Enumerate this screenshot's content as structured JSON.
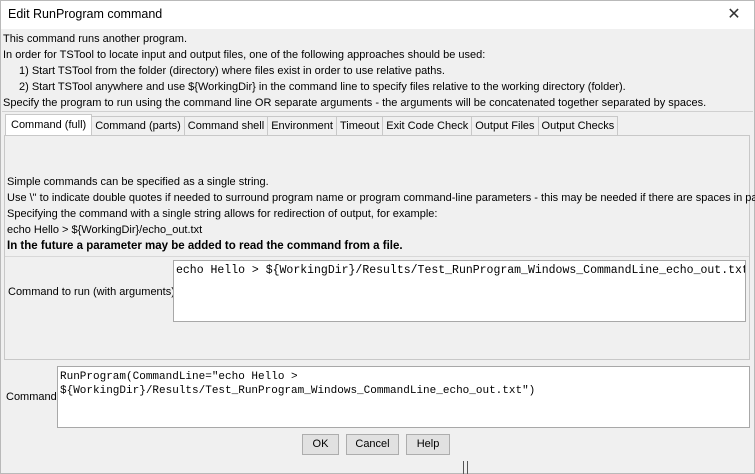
{
  "window": {
    "title": "Edit RunProgram command",
    "close_glyph": "✕"
  },
  "intro": [
    "This command runs another program.",
    "In order for TSTool to locate input and output files, one of the following approaches should be used:",
    "1) Start TSTool from the folder (directory) where files exist in order to use relative paths.",
    "2) Start TSTool anywhere and use ${WorkingDir} in the command line to specify files relative to the working directory (folder).",
    "Specify the program to run using the command line OR separate arguments - the arguments will be concatenated together separated by spaces."
  ],
  "tabs": [
    {
      "label": "Command (full)",
      "active": true
    },
    {
      "label": "Command (parts)",
      "active": false
    },
    {
      "label": "Command shell",
      "active": false
    },
    {
      "label": "Environment",
      "active": false
    },
    {
      "label": "Timeout",
      "active": false
    },
    {
      "label": "Exit Code Check",
      "active": false
    },
    {
      "label": "Output Files",
      "active": false
    },
    {
      "label": "Output Checks",
      "active": false
    }
  ],
  "panel": {
    "help": [
      "Simple commands can be specified as a single string.",
      "Use \\\" to indicate double quotes if needed to surround program name or program command-line parameters - this may be needed if there are spaces in paths.",
      "Specifying the command with a single string allows for redirection of output, for example:",
      "echo Hello > ${WorkingDir}/echo_out.txt",
      "In the future a parameter may be added to read the command from a file."
    ],
    "command_to_run_label": "Command to run (with arguments):",
    "command_to_run_value": "echo Hello > ${WorkingDir}/Results/Test_RunProgram_Windows_CommandLine_echo_out.txt"
  },
  "command": {
    "label": "Command:",
    "value": "RunProgram(CommandLine=\"echo Hello >\n${WorkingDir}/Results/Test_RunProgram_Windows_CommandLine_echo_out.txt\")"
  },
  "buttons": {
    "ok": "OK",
    "cancel": "Cancel",
    "help": "Help"
  }
}
